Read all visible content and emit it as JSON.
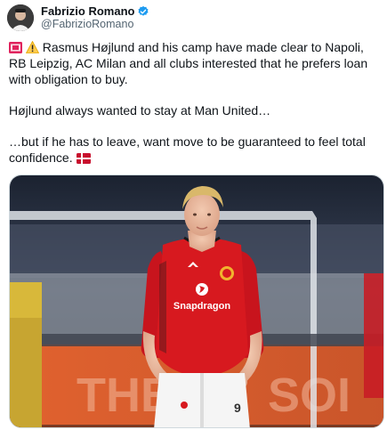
{
  "author": {
    "display_name": "Fabrizio Romano",
    "handle": "@FabrizioRomano",
    "verified": true,
    "verified_color": "#1d9bf0",
    "avatar_icon": "profile-photo"
  },
  "tweet": {
    "line1_prefix_icons": [
      "red-flag-icon",
      "warning-icon"
    ],
    "paragraph1": "Rasmus Højlund and his camp have made clear to Napoli, RB Leipzig, AC Milan and all clubs interested that he prefers loan with obligation to buy.",
    "paragraph2": "Højlund always wanted to stay at Man United…",
    "paragraph3": "…but if he has to leave, want move to be guaranteed to feel total confidence.",
    "paragraph3_suffix_icon": "denmark-flag-icon"
  },
  "media": {
    "type": "photo",
    "shirt_sponsor": "Snapdragon",
    "shirt_color": "#d7191f"
  }
}
